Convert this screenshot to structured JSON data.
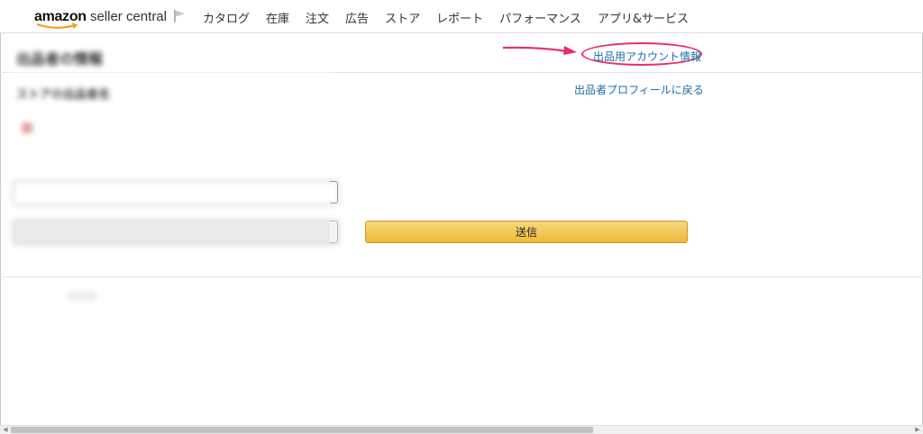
{
  "header": {
    "logo": {
      "main": "amazon",
      "sub": " seller central"
    },
    "nav": [
      "カタログ",
      "在庫",
      "注文",
      "広告",
      "ストア",
      "レポート",
      "パフォーマンス",
      "アプリ&サービス"
    ]
  },
  "page": {
    "title": "出品者の情報",
    "account_link": "出品用アカウント情報",
    "profile_link": "出品者プロフィールに戻る"
  },
  "form": {
    "section_heading": "ストアの出品者名",
    "store_name": "",
    "field_label": "",
    "field_hint": "",
    "input_value": "",
    "secondary_button": "",
    "submit_label": "送信"
  },
  "footer": {
    "help": "",
    "policy": "",
    "language": ""
  },
  "colors": {
    "link": "#1b6ea8",
    "highlight": "#e62e6b",
    "submit": "#f0c14b"
  }
}
